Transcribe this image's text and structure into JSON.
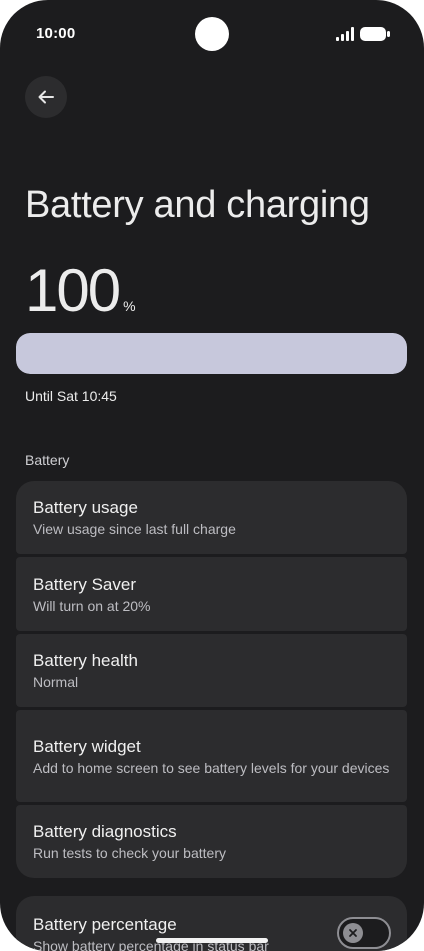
{
  "status_bar": {
    "time": "10:00"
  },
  "header": {
    "title": "Battery and charging"
  },
  "battery_level": {
    "value": "100",
    "unit": "%",
    "fill_fraction": 1.0,
    "fill_color": "#c7c8dc"
  },
  "until_text": "Until Sat 10:45",
  "section": {
    "label": "Battery"
  },
  "items": [
    {
      "title": "Battery usage",
      "subtitle": "View usage since last full charge"
    },
    {
      "title": "Battery Saver",
      "subtitle": "Will turn on at 20%"
    },
    {
      "title": "Battery health",
      "subtitle": "Normal"
    },
    {
      "title": "Battery widget",
      "subtitle": "Add to home screen to see battery levels for your devices"
    },
    {
      "title": "Battery diagnostics",
      "subtitle": "Run tests to check your battery"
    }
  ],
  "percentage_setting": {
    "title": "Battery percentage",
    "subtitle": "Show battery percentage in status bar",
    "enabled": false
  },
  "icons": [
    "back-arrow-icon",
    "signal-icon",
    "battery-icon",
    "close-icon"
  ]
}
